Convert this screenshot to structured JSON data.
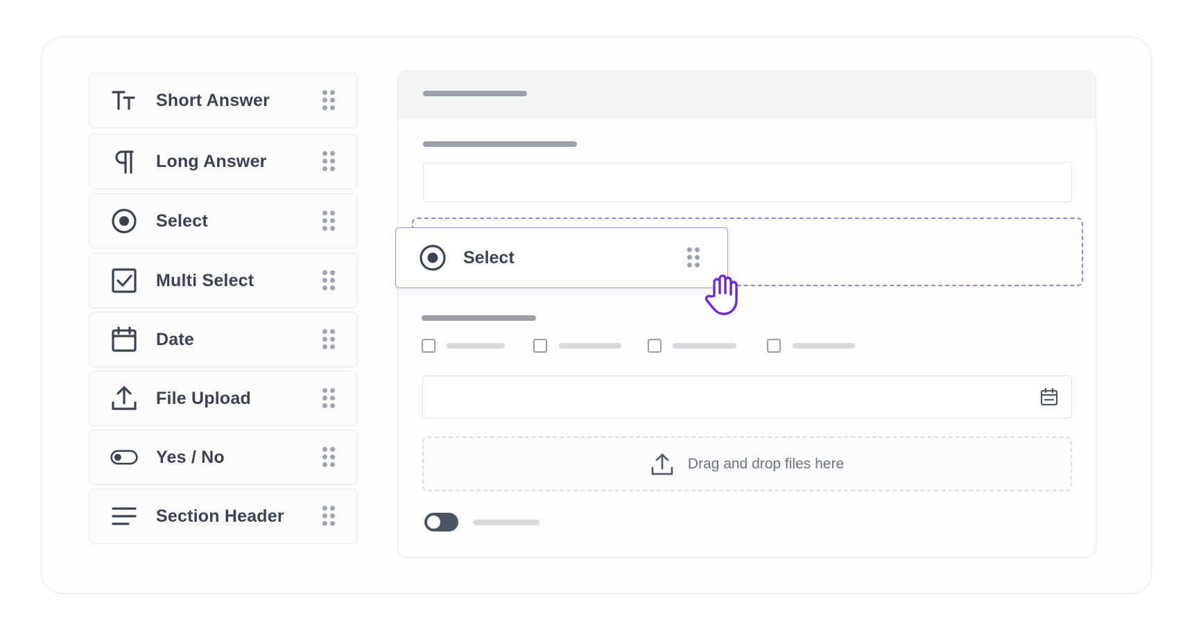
{
  "palette": {
    "items": [
      {
        "label": "Short Answer",
        "icon": "text-size-icon"
      },
      {
        "label": "Long Answer",
        "icon": "paragraph-icon"
      },
      {
        "label": "Select",
        "icon": "radio-icon"
      },
      {
        "label": "Multi Select",
        "icon": "checkbox-icon"
      },
      {
        "label": "Date",
        "icon": "calendar-icon"
      },
      {
        "label": "File Upload",
        "icon": "upload-icon"
      },
      {
        "label": "Yes / No",
        "icon": "toggle-icon"
      },
      {
        "label": "Section Header",
        "icon": "lines-icon"
      }
    ]
  },
  "drag_preview": {
    "label": "Select",
    "icon": "radio-icon"
  },
  "canvas": {
    "upload_text": "Drag and drop files here"
  },
  "colors": {
    "accent": "#7c3aed",
    "accent_light": "#a78bfa",
    "text": "#3b4352",
    "muted": "#9aa0aa"
  }
}
